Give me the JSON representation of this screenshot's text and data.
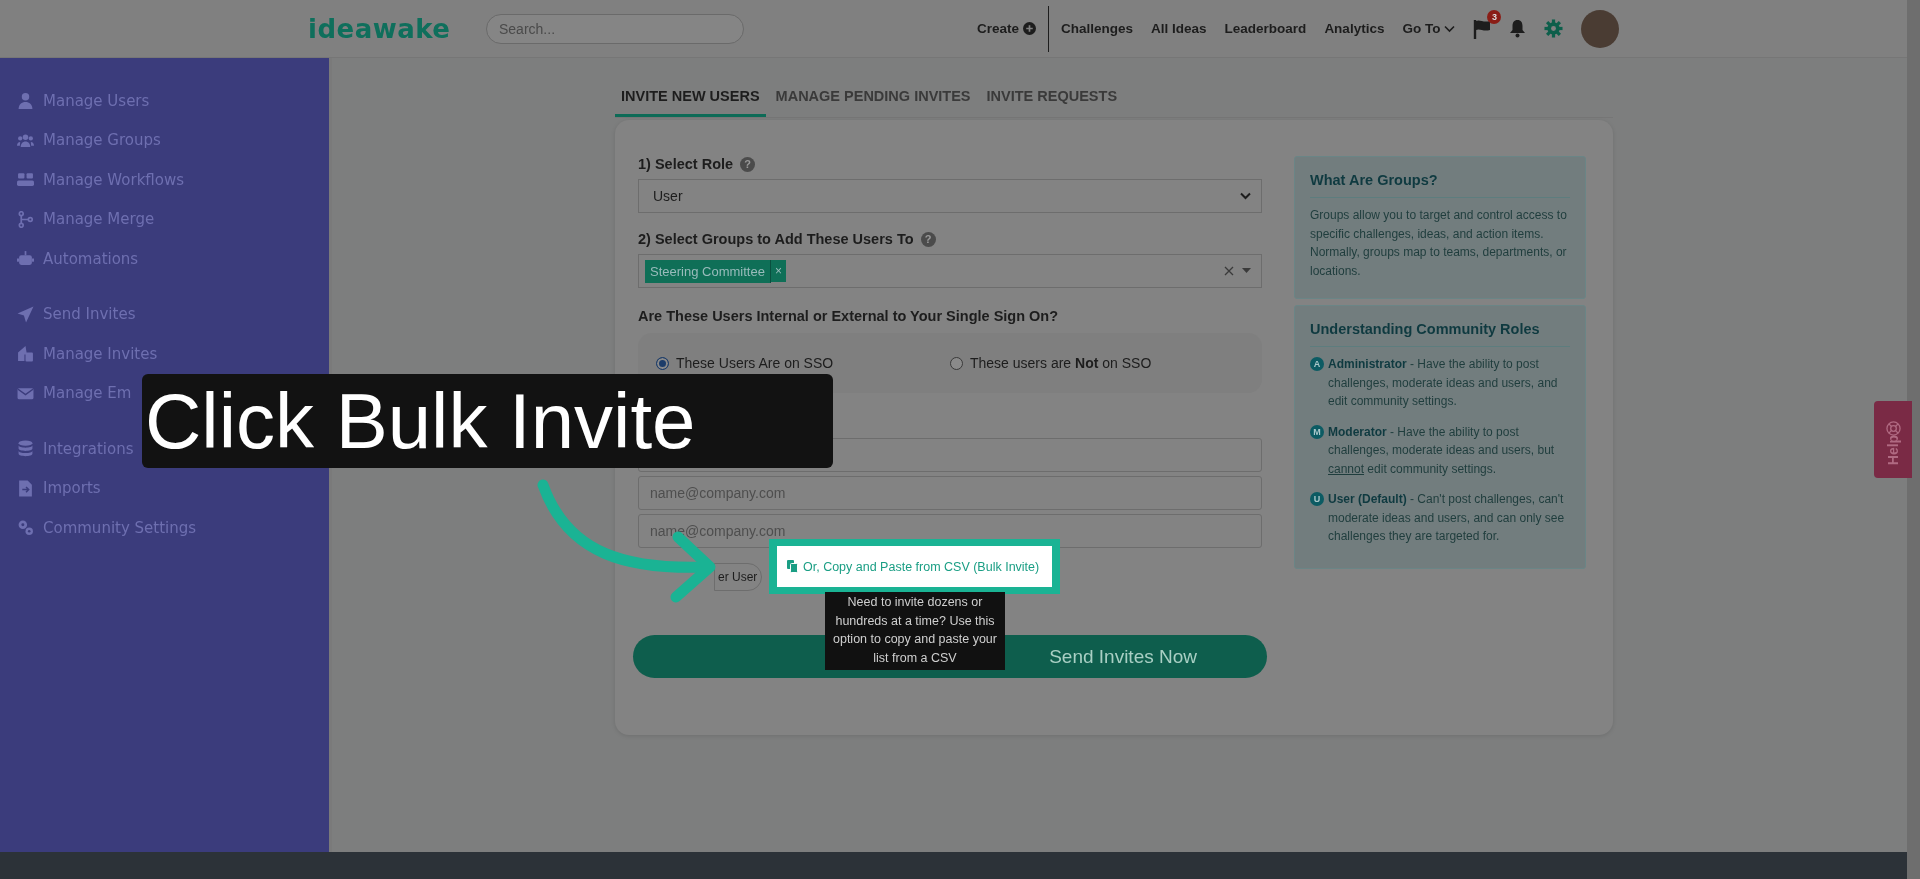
{
  "top_nav": {
    "logo": "ideawake",
    "search": {
      "placeholder": "Search..."
    },
    "links": [
      {
        "label": "Create",
        "kind": "create"
      },
      {
        "label": "Challenges",
        "kind": "link"
      },
      {
        "label": "All Ideas",
        "kind": "link"
      },
      {
        "label": "Leaderboard",
        "kind": "link"
      },
      {
        "label": "Analytics",
        "kind": "link"
      },
      {
        "label": "Go To",
        "kind": "dropdown"
      }
    ],
    "flag_badge": "3"
  },
  "sidebar": {
    "groups": [
      [
        {
          "label": "Manage Users"
        },
        {
          "label": "Manage Groups"
        },
        {
          "label": "Manage Workflows"
        },
        {
          "label": "Manage Merge"
        },
        {
          "label": "Automations"
        }
      ],
      [
        {
          "label": "Send Invites"
        },
        {
          "label": "Manage Invites"
        },
        {
          "label": "Manage Em"
        }
      ],
      [
        {
          "label": "Integrations"
        },
        {
          "label": "Imports"
        },
        {
          "label": "Community Settings"
        }
      ]
    ]
  },
  "tabs": [
    {
      "label": "INVITE NEW USERS",
      "selected": true
    },
    {
      "label": "MANAGE PENDING INVITES",
      "selected": false
    },
    {
      "label": "INVITE REQUESTS",
      "selected": false
    }
  ],
  "form": {
    "role_label": "1) Select Role",
    "role_value": "User",
    "groups_label": "2) Select Groups to Add These Users To",
    "group_tags": [
      "Steering Committee"
    ],
    "sso_question": "Are These Users Internal or External to Your Single Sign On?",
    "sso_options": [
      {
        "label": "These Users Are on SSO",
        "selected": true
      },
      {
        "label": "These users are **Not** on SSO",
        "selected": false
      }
    ],
    "email_placeholders": [
      "name@company.com",
      "name@company.com"
    ],
    "help_mark": "?",
    "tag_remove": "×",
    "add_user_button": "er User",
    "submit_button": "Send Invites Now"
  },
  "info_panels": [
    {
      "title": "What Are Groups?",
      "body": "Groups allow you to target and control access to specific challenges, ideas, and action items. Normally, groups map to teams, departments, or locations."
    },
    {
      "title": "Understanding Community Roles",
      "roles": [
        {
          "badge": "A",
          "name": "Administrator",
          "text": " - Have the ability to post challenges, moderate ideas and users, and edit community settings."
        },
        {
          "badge": "M",
          "name": "Moderator",
          "text": " - Have the ability to post challenges, moderate ideas and users, but ",
          "underlined": "cannot",
          "text_after": " edit community settings."
        },
        {
          "badge": "U",
          "name": "User (Default)",
          "text": " - Can't post challenges, can't moderate ideas and users, and can only see challenges they are targeted for."
        }
      ]
    }
  ],
  "bulk_invite_button": "Or, Copy and Paste from CSV (Bulk Invite)",
  "tooltip": "Need to invite dozens or hundreds at a time? Use this option to copy and paste your list from a CSV",
  "caption": "Click Bulk Invite",
  "help_tab": "Help"
}
